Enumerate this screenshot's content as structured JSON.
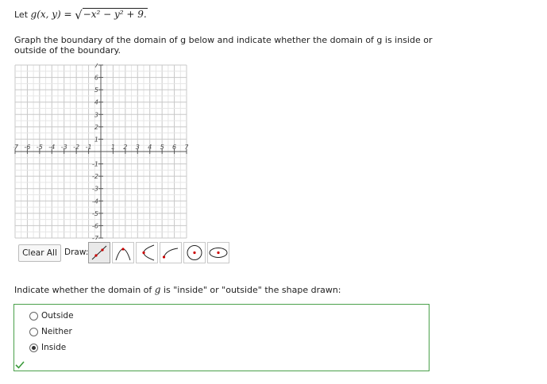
{
  "intro": {
    "prefix": "Let ",
    "function_lhs": "g(x, y) =",
    "radicand": "−x² − y² + 9."
  },
  "question_text": "Graph the boundary of the domain of g below and indicate whether the domain of g is inside or outside of the boundary.",
  "graph": {
    "x_min": -7,
    "x_max": 7,
    "y_min": -7,
    "y_max": 7,
    "grid": true,
    "x_ticks": [
      "-7",
      "-6",
      "-5",
      "-4",
      "-3",
      "-2",
      "-1",
      "1",
      "2",
      "3",
      "4",
      "5",
      "6",
      "7"
    ],
    "y_ticks": [
      "7",
      "6",
      "5",
      "4",
      "3",
      "2",
      "1",
      "-1",
      "-2",
      "-3",
      "-4",
      "-5",
      "-6",
      "-7"
    ]
  },
  "controls": {
    "clear_all_label": "Clear All",
    "draw_label": "Draw:",
    "tools": [
      {
        "icon": "line-tool-icon",
        "active": true
      },
      {
        "icon": "parabola-tool-icon",
        "active": false
      },
      {
        "icon": "sideways-parabola-tool-icon",
        "active": false
      },
      {
        "icon": "square-root-tool-icon",
        "active": false
      },
      {
        "icon": "circle-tool-icon",
        "active": false
      },
      {
        "icon": "ellipse-tool-icon",
        "active": false
      }
    ]
  },
  "domain_question": {
    "prefix": "Indicate whether the domain of ",
    "var": "g",
    "suffix": " is \"inside\" or \"outside\" the shape drawn:"
  },
  "options": [
    {
      "label": "Outside",
      "selected": false
    },
    {
      "label": "Neither",
      "selected": false
    },
    {
      "label": "Inside",
      "selected": true
    }
  ],
  "colors": {
    "correct_border": "#4aa04a",
    "check": "#3a9a3a",
    "draw_red": "#cc0000"
  }
}
